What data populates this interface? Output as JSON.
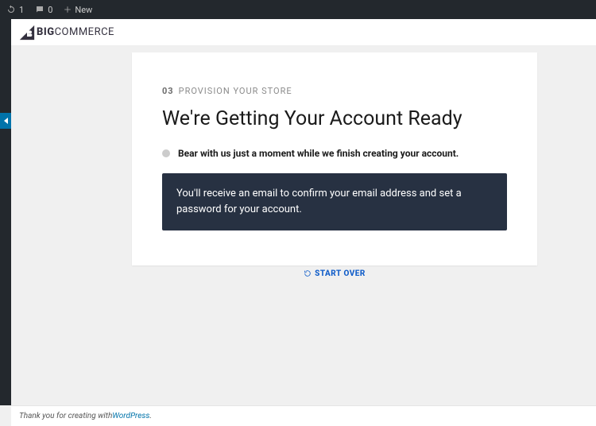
{
  "adminbar": {
    "updates_count": "1",
    "comments_count": "0",
    "new_label": "New"
  },
  "brand": {
    "name_bold": "BIG",
    "name_rest": "COMMERCE"
  },
  "step": {
    "number": "03",
    "label": "PROVISION YOUR STORE"
  },
  "title": "We're Getting Your Account Ready",
  "status": "Bear with us just a moment while we finish creating your account.",
  "info": "You'll receive an email to confirm your email address and set a password for your account.",
  "start_over": "START OVER",
  "footer": {
    "prefix": "Thank you for creating with ",
    "link_label": "WordPress",
    "suffix": "."
  }
}
